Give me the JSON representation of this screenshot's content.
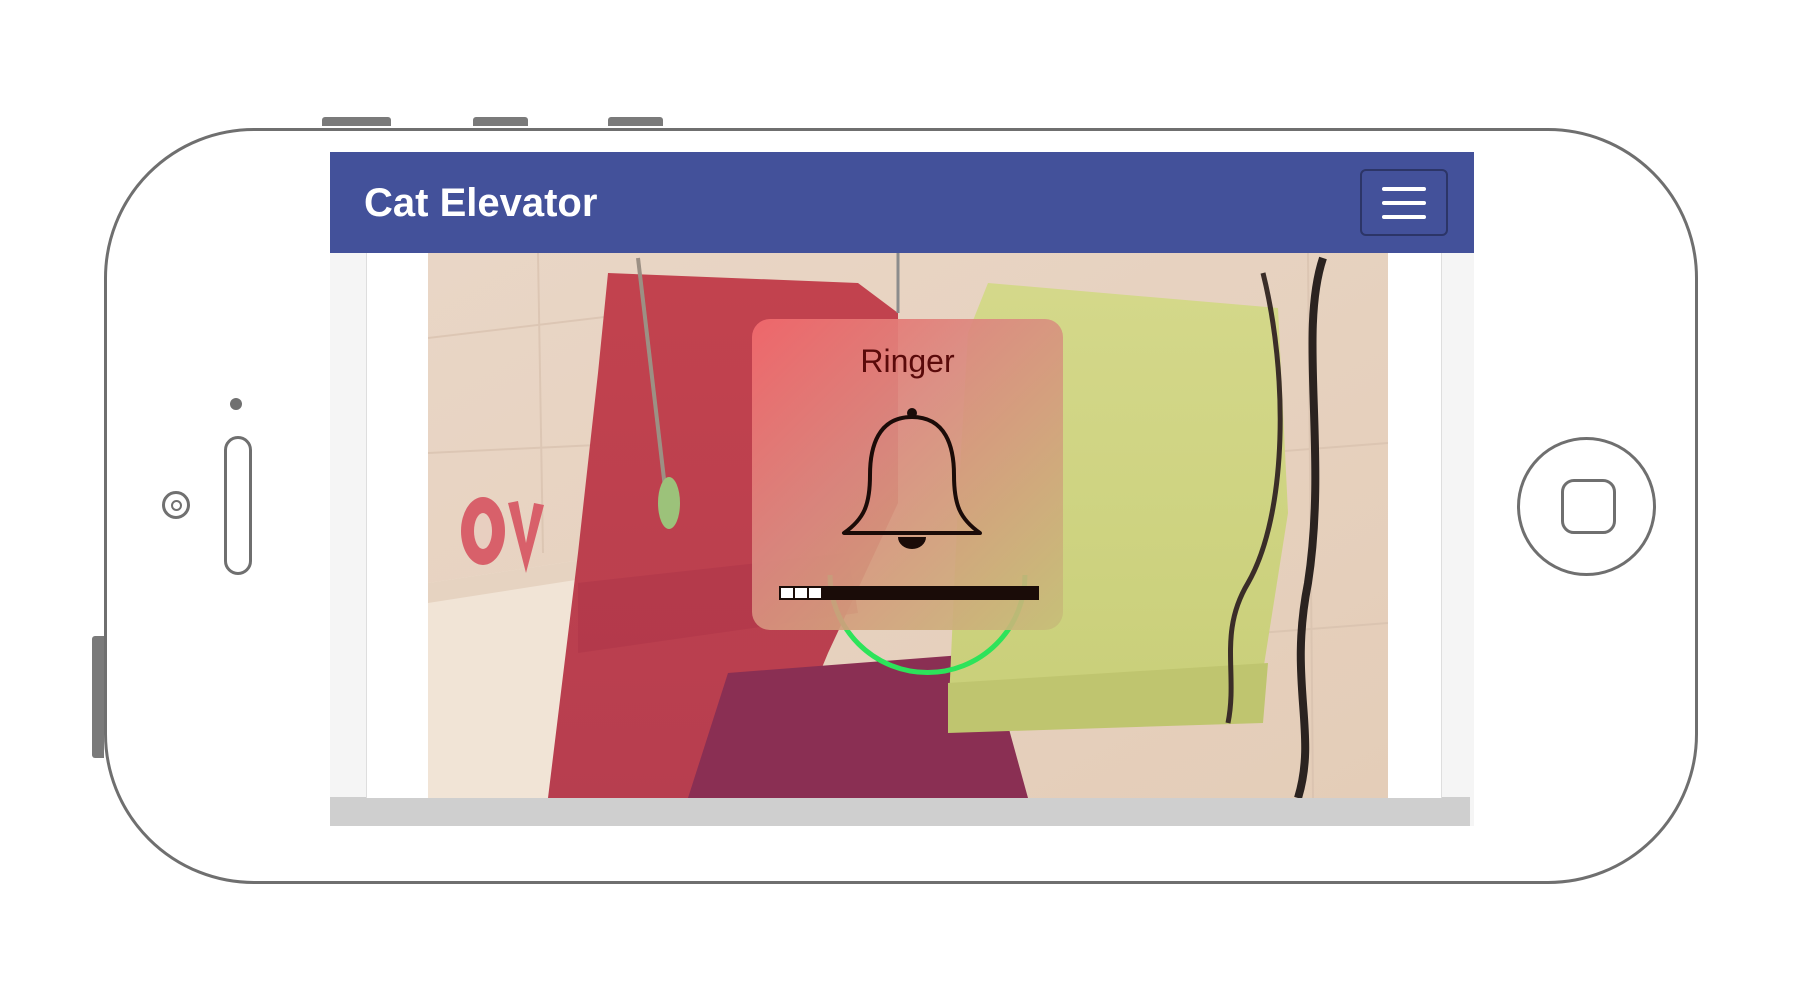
{
  "app": {
    "title": "Cat Elevator"
  },
  "navbar": {
    "menu_icon": "hamburger-menu-icon"
  },
  "camera_feed": {
    "description_icon": "live-camera-feed"
  },
  "ringer_hud": {
    "title": "Ringer",
    "icon": "bell-icon",
    "volume_level": 0.1875,
    "volume_segments_on": 3,
    "volume_segments_total": 16
  },
  "colors": {
    "navbar": "#43519a",
    "brand_text": "#ffffff",
    "hud_title": "#5a0a0a",
    "indicator_ring": "#2de35a"
  }
}
